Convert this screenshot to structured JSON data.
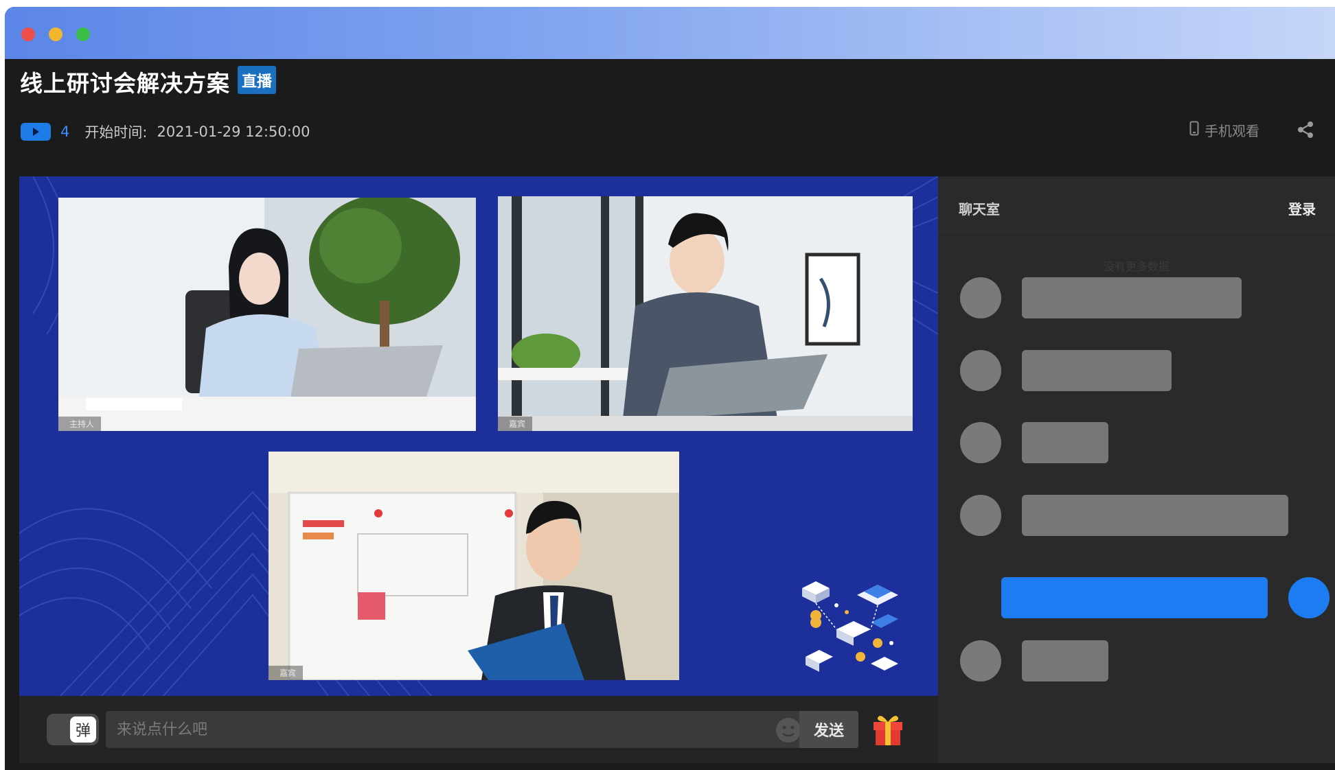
{
  "window": {
    "title": "线上研讨会解决方案",
    "live_badge": "直播",
    "viewer_count": "4",
    "start_label": "开始时间:",
    "start_time": "2021-01-29 12:50:00",
    "mobile_watch": "手机观看"
  },
  "videos": [
    {
      "role_label": "主持人"
    },
    {
      "role_label": "嘉宾"
    },
    {
      "role_label": "嘉宾"
    }
  ],
  "input_bar": {
    "danmu_label": "弹",
    "placeholder": "来说点什么吧",
    "send_label": "发送"
  },
  "chat": {
    "title": "聊天室",
    "login": "登录",
    "no_more": "没有更多数据"
  },
  "colors": {
    "accent": "#1e7cf2",
    "stage_bg": "#1d2f9a",
    "badge": "#1a6fbf"
  }
}
